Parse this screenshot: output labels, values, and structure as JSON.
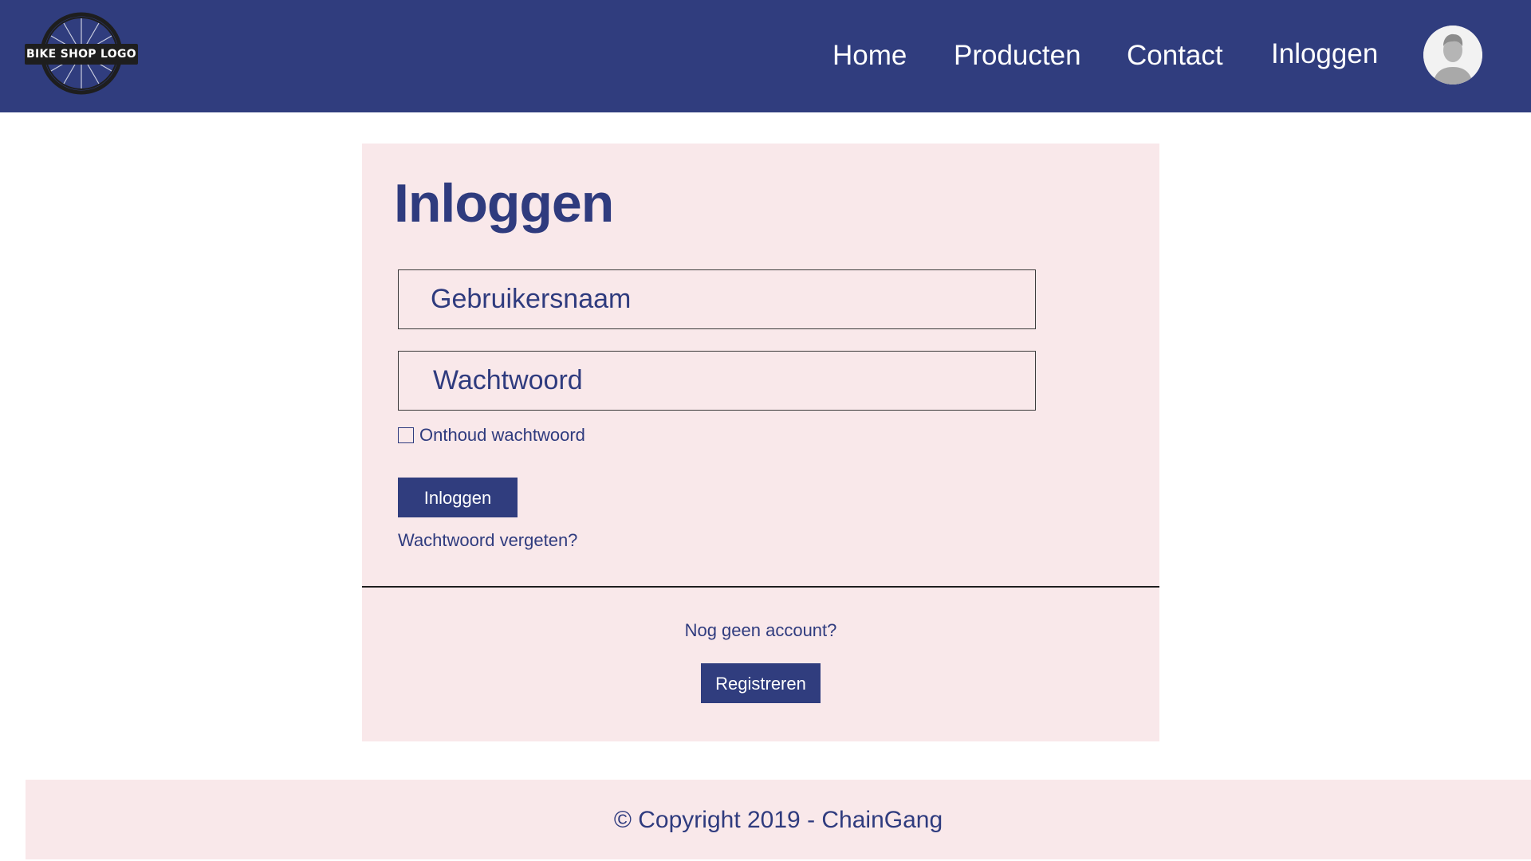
{
  "header": {
    "logo_text": "BIKE SHOP LOGO",
    "nav": {
      "home": "Home",
      "products": "Producten",
      "contact": "Contact",
      "login": "Inloggen"
    },
    "avatar_icon": "user-avatar-icon",
    "background_color": "#303d7e"
  },
  "login_panel": {
    "title": "Inloggen",
    "username_placeholder": "Gebruikersnaam",
    "password_placeholder": "Wachtwoord",
    "remember_label": "Onthoud wachtwoord",
    "remember_checked": false,
    "submit_label": "Inloggen",
    "forgot_label": "Wachtwoord vergeten?",
    "no_account_label": "Nog geen account?",
    "register_label": "Registreren",
    "background_color": "#f9e8ea"
  },
  "footer": {
    "copyright": "© Copyright 2019 - ChainGang"
  },
  "colors": {
    "primary": "#303d7e",
    "panel": "#f9e8ea",
    "text": "#2f3b7e"
  }
}
